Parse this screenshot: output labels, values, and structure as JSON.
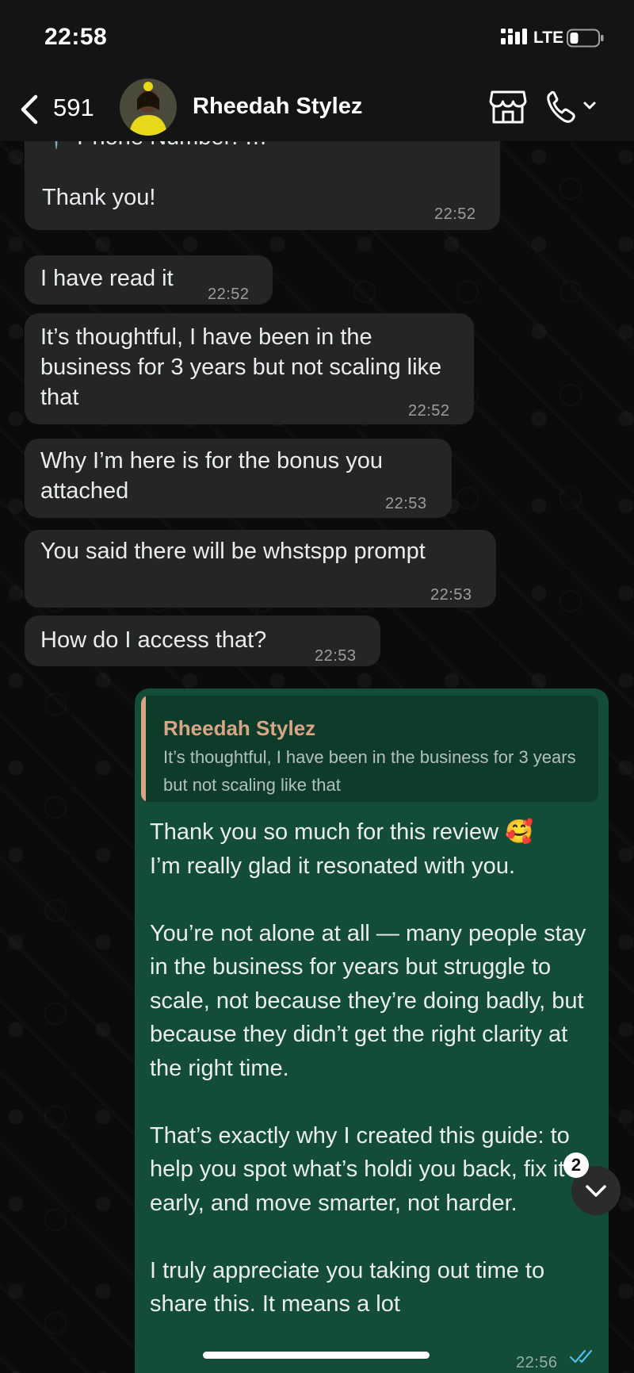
{
  "status_bar": {
    "time": "22:58",
    "network": "LTE"
  },
  "header": {
    "back_count": "591",
    "contact_name": "Rheedah Stylez"
  },
  "messages": [
    {
      "text": "📍 Phone Number: …\n\nThank you!",
      "time": "22:52"
    },
    {
      "text": "I have read it",
      "time": "22:52"
    },
    {
      "text": "It’s thoughtful, I have been in the business for 3 years but not scaling like that",
      "time": "22:52"
    },
    {
      "text": "Why I’m here is for the bonus you attached",
      "time": "22:53"
    },
    {
      "text": "You said there will be whstspp prompt",
      "time": "22:53"
    },
    {
      "text": "How do I access that?",
      "time": "22:53"
    }
  ],
  "reply": {
    "quoted_author": "Rheedah Stylez",
    "quoted_text": "It’s thoughtful, I have been in the business for 3 years but not scaling like that",
    "text": "Thank you so much for this review 🥰\nI’m really glad it resonated with you.\n\nYou’re not alone at all — many people stay in the business for years but struggle to scale, not because they’re doing badly, but because they didn’t get the right clarity at the right time.\n\nThat’s exactly why I created this guide: to help you spot what’s holdi you back, fix it early, and move smarter, not harder.\n\nI truly appreciate you taking out time to share this. It means a lot",
    "time": "22:56"
  },
  "scroll": {
    "unread_count": "2"
  },
  "colors": {
    "incoming_bubble": "#242626",
    "outgoing_bubble": "#134d37",
    "quote_accent": "#d8a585",
    "read_ticks": "#53bdeb"
  }
}
